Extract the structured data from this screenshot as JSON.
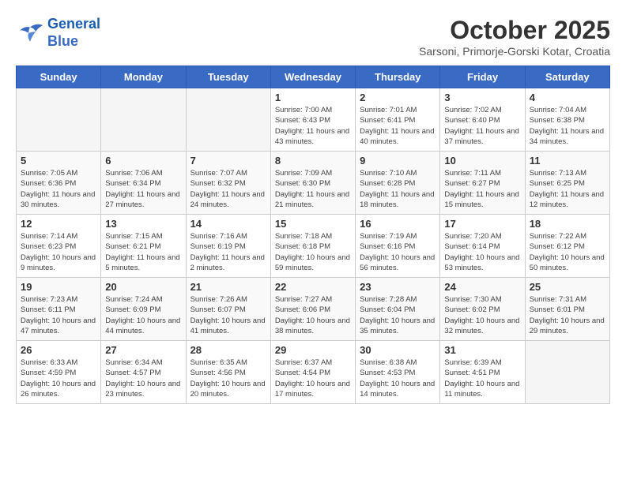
{
  "header": {
    "logo_line1": "General",
    "logo_line2": "Blue",
    "title": "October 2025",
    "subtitle": "Sarsoni, Primorje-Gorski Kotar, Croatia"
  },
  "weekdays": [
    "Sunday",
    "Monday",
    "Tuesday",
    "Wednesday",
    "Thursday",
    "Friday",
    "Saturday"
  ],
  "weeks": [
    [
      {
        "day": "",
        "empty": true
      },
      {
        "day": "",
        "empty": true
      },
      {
        "day": "",
        "empty": true
      },
      {
        "day": "1",
        "sunrise": "7:00 AM",
        "sunset": "6:43 PM",
        "daylight": "11 hours and 43 minutes."
      },
      {
        "day": "2",
        "sunrise": "7:01 AM",
        "sunset": "6:41 PM",
        "daylight": "11 hours and 40 minutes."
      },
      {
        "day": "3",
        "sunrise": "7:02 AM",
        "sunset": "6:40 PM",
        "daylight": "11 hours and 37 minutes."
      },
      {
        "day": "4",
        "sunrise": "7:04 AM",
        "sunset": "6:38 PM",
        "daylight": "11 hours and 34 minutes."
      }
    ],
    [
      {
        "day": "5",
        "sunrise": "7:05 AM",
        "sunset": "6:36 PM",
        "daylight": "11 hours and 30 minutes."
      },
      {
        "day": "6",
        "sunrise": "7:06 AM",
        "sunset": "6:34 PM",
        "daylight": "11 hours and 27 minutes."
      },
      {
        "day": "7",
        "sunrise": "7:07 AM",
        "sunset": "6:32 PM",
        "daylight": "11 hours and 24 minutes."
      },
      {
        "day": "8",
        "sunrise": "7:09 AM",
        "sunset": "6:30 PM",
        "daylight": "11 hours and 21 minutes."
      },
      {
        "day": "9",
        "sunrise": "7:10 AM",
        "sunset": "6:28 PM",
        "daylight": "11 hours and 18 minutes."
      },
      {
        "day": "10",
        "sunrise": "7:11 AM",
        "sunset": "6:27 PM",
        "daylight": "11 hours and 15 minutes."
      },
      {
        "day": "11",
        "sunrise": "7:13 AM",
        "sunset": "6:25 PM",
        "daylight": "11 hours and 12 minutes."
      }
    ],
    [
      {
        "day": "12",
        "sunrise": "7:14 AM",
        "sunset": "6:23 PM",
        "daylight": "10 hours and 9 minutes."
      },
      {
        "day": "13",
        "sunrise": "7:15 AM",
        "sunset": "6:21 PM",
        "daylight": "11 hours and 5 minutes."
      },
      {
        "day": "14",
        "sunrise": "7:16 AM",
        "sunset": "6:19 PM",
        "daylight": "11 hours and 2 minutes."
      },
      {
        "day": "15",
        "sunrise": "7:18 AM",
        "sunset": "6:18 PM",
        "daylight": "10 hours and 59 minutes."
      },
      {
        "day": "16",
        "sunrise": "7:19 AM",
        "sunset": "6:16 PM",
        "daylight": "10 hours and 56 minutes."
      },
      {
        "day": "17",
        "sunrise": "7:20 AM",
        "sunset": "6:14 PM",
        "daylight": "10 hours and 53 minutes."
      },
      {
        "day": "18",
        "sunrise": "7:22 AM",
        "sunset": "6:12 PM",
        "daylight": "10 hours and 50 minutes."
      }
    ],
    [
      {
        "day": "19",
        "sunrise": "7:23 AM",
        "sunset": "6:11 PM",
        "daylight": "10 hours and 47 minutes."
      },
      {
        "day": "20",
        "sunrise": "7:24 AM",
        "sunset": "6:09 PM",
        "daylight": "10 hours and 44 minutes."
      },
      {
        "day": "21",
        "sunrise": "7:26 AM",
        "sunset": "6:07 PM",
        "daylight": "10 hours and 41 minutes."
      },
      {
        "day": "22",
        "sunrise": "7:27 AM",
        "sunset": "6:06 PM",
        "daylight": "10 hours and 38 minutes."
      },
      {
        "day": "23",
        "sunrise": "7:28 AM",
        "sunset": "6:04 PM",
        "daylight": "10 hours and 35 minutes."
      },
      {
        "day": "24",
        "sunrise": "7:30 AM",
        "sunset": "6:02 PM",
        "daylight": "10 hours and 32 minutes."
      },
      {
        "day": "25",
        "sunrise": "7:31 AM",
        "sunset": "6:01 PM",
        "daylight": "10 hours and 29 minutes."
      }
    ],
    [
      {
        "day": "26",
        "sunrise": "6:33 AM",
        "sunset": "4:59 PM",
        "daylight": "10 hours and 26 minutes."
      },
      {
        "day": "27",
        "sunrise": "6:34 AM",
        "sunset": "4:57 PM",
        "daylight": "10 hours and 23 minutes."
      },
      {
        "day": "28",
        "sunrise": "6:35 AM",
        "sunset": "4:56 PM",
        "daylight": "10 hours and 20 minutes."
      },
      {
        "day": "29",
        "sunrise": "6:37 AM",
        "sunset": "4:54 PM",
        "daylight": "10 hours and 17 minutes."
      },
      {
        "day": "30",
        "sunrise": "6:38 AM",
        "sunset": "4:53 PM",
        "daylight": "10 hours and 14 minutes."
      },
      {
        "day": "31",
        "sunrise": "6:39 AM",
        "sunset": "4:51 PM",
        "daylight": "10 hours and 11 minutes."
      },
      {
        "day": "",
        "empty": true
      }
    ]
  ]
}
